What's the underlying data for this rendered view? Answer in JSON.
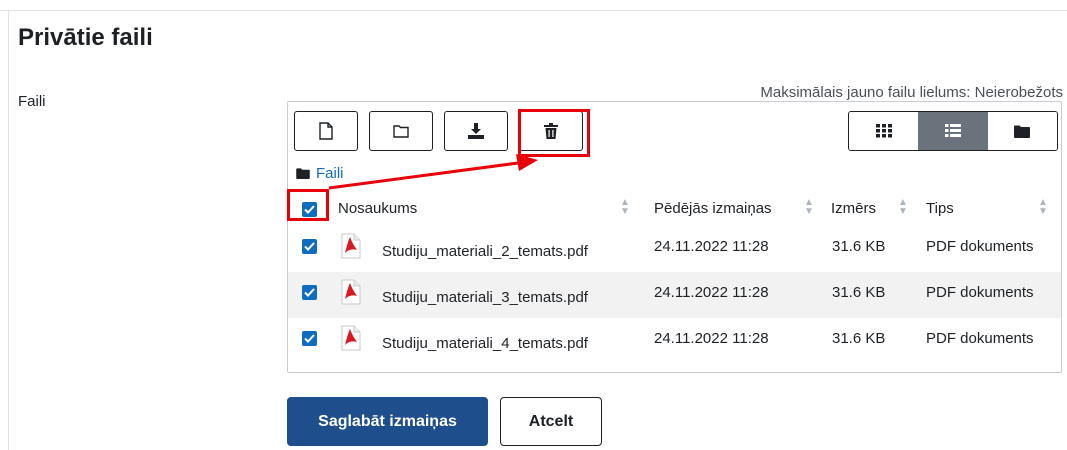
{
  "page": {
    "title": "Privātie faili",
    "field_label": "Faili",
    "max_size_text": "Maksimālais jauno failu lielums: Neierobežots"
  },
  "toolbar": {
    "add_file_icon": "file-icon",
    "create_folder_icon": "folder-icon",
    "download_icon": "download-icon",
    "delete_icon": "trash-icon"
  },
  "views": {
    "icons": "grid-icon",
    "details": "list-icon",
    "tree": "folder-solid-icon",
    "active": "details"
  },
  "breadcrumb": {
    "label": "Faili"
  },
  "table": {
    "headers": {
      "name": "Nosaukums",
      "modified": "Pēdējās izmaiņas",
      "size": "Izmērs",
      "type": "Tips"
    },
    "select_all_checked": true,
    "rows": [
      {
        "checked": true,
        "name": "Studiju_materiali_2_temats.pdf",
        "modified": "24.11.2022 11:28",
        "size": "31.6 KB",
        "type": "PDF dokuments"
      },
      {
        "checked": true,
        "name": "Studiju_materiali_3_temats.pdf",
        "modified": "24.11.2022 11:28",
        "size": "31.6 KB",
        "type": "PDF dokuments"
      },
      {
        "checked": true,
        "name": "Studiju_materiali_4_temats.pdf",
        "modified": "24.11.2022 11:28",
        "size": "31.6 KB",
        "type": "PDF dokuments"
      }
    ]
  },
  "actions": {
    "save_label": "Saglabāt izmaiņas",
    "cancel_label": "Atcelt"
  },
  "colors": {
    "accent": "#0f6cbf",
    "primary_button": "#1e4e8c",
    "annotation": "#e8000b",
    "active_view": "#6a737b",
    "pdf_red": "#d71921"
  }
}
